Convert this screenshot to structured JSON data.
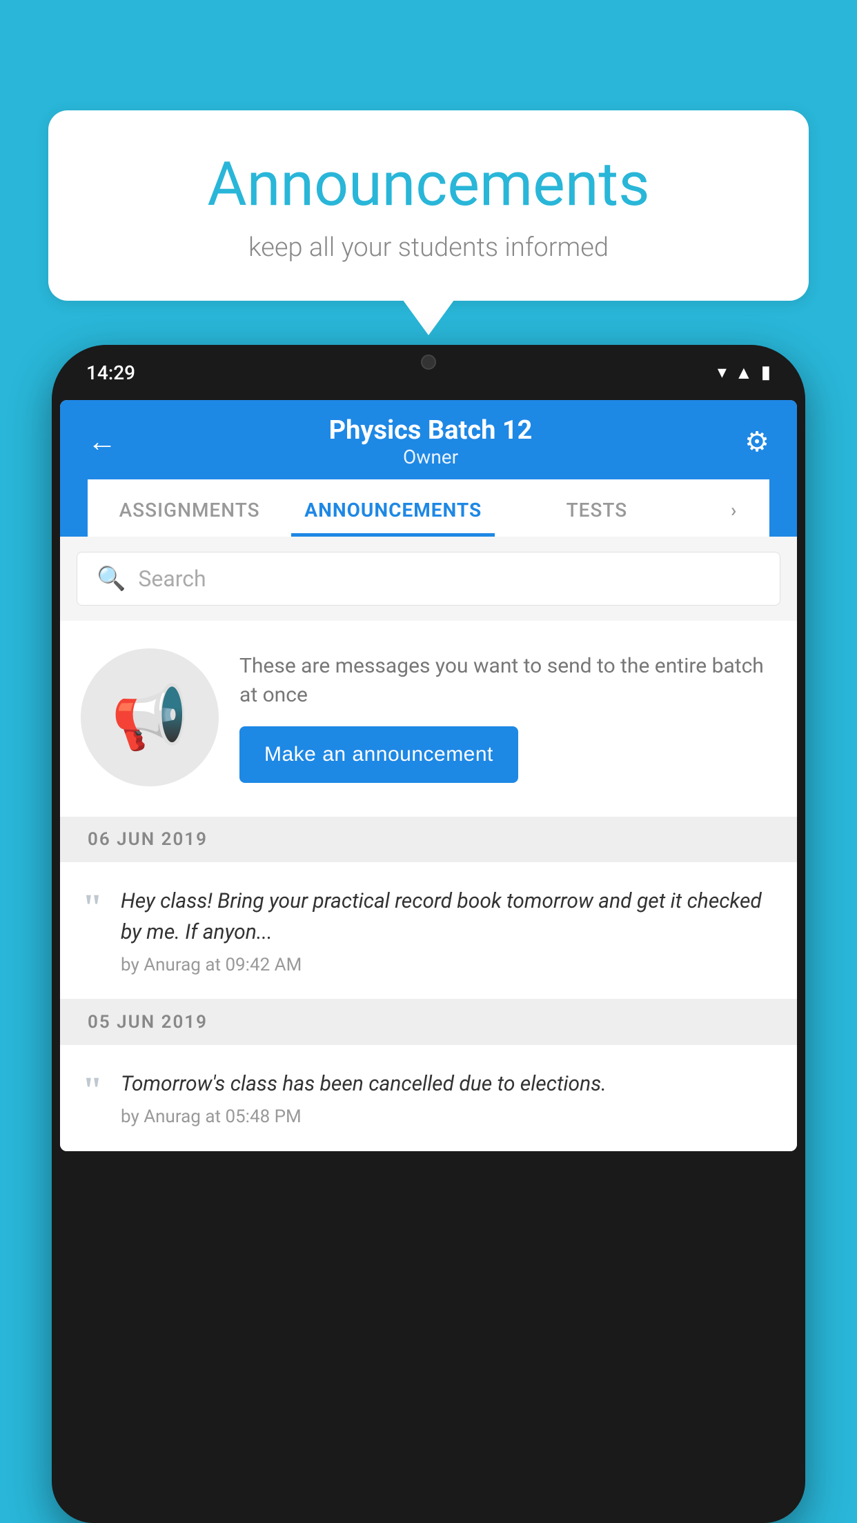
{
  "background_color": "#29b6d8",
  "bubble": {
    "title": "Announcements",
    "subtitle": "keep all your students informed"
  },
  "phone": {
    "status_bar": {
      "time": "14:29"
    },
    "header": {
      "title": "Physics Batch 12",
      "subtitle": "Owner",
      "back_label": "←",
      "settings_label": "⚙"
    },
    "tabs": [
      {
        "label": "ASSIGNMENTS",
        "active": false
      },
      {
        "label": "ANNOUNCEMENTS",
        "active": true
      },
      {
        "label": "TESTS",
        "active": false
      },
      {
        "label": "›",
        "active": false
      }
    ],
    "search": {
      "placeholder": "Search"
    },
    "promo": {
      "description": "These are messages you want to send to the entire batch at once",
      "button_label": "Make an announcement"
    },
    "announcements": [
      {
        "date": "06  JUN  2019",
        "text": "Hey class! Bring your practical record book tomorrow and get it checked by me. If anyon...",
        "meta": "by Anurag at 09:42 AM"
      },
      {
        "date": "05  JUN  2019",
        "text": "Tomorrow's class has been cancelled due to elections.",
        "meta": "by Anurag at 05:48 PM"
      }
    ]
  }
}
